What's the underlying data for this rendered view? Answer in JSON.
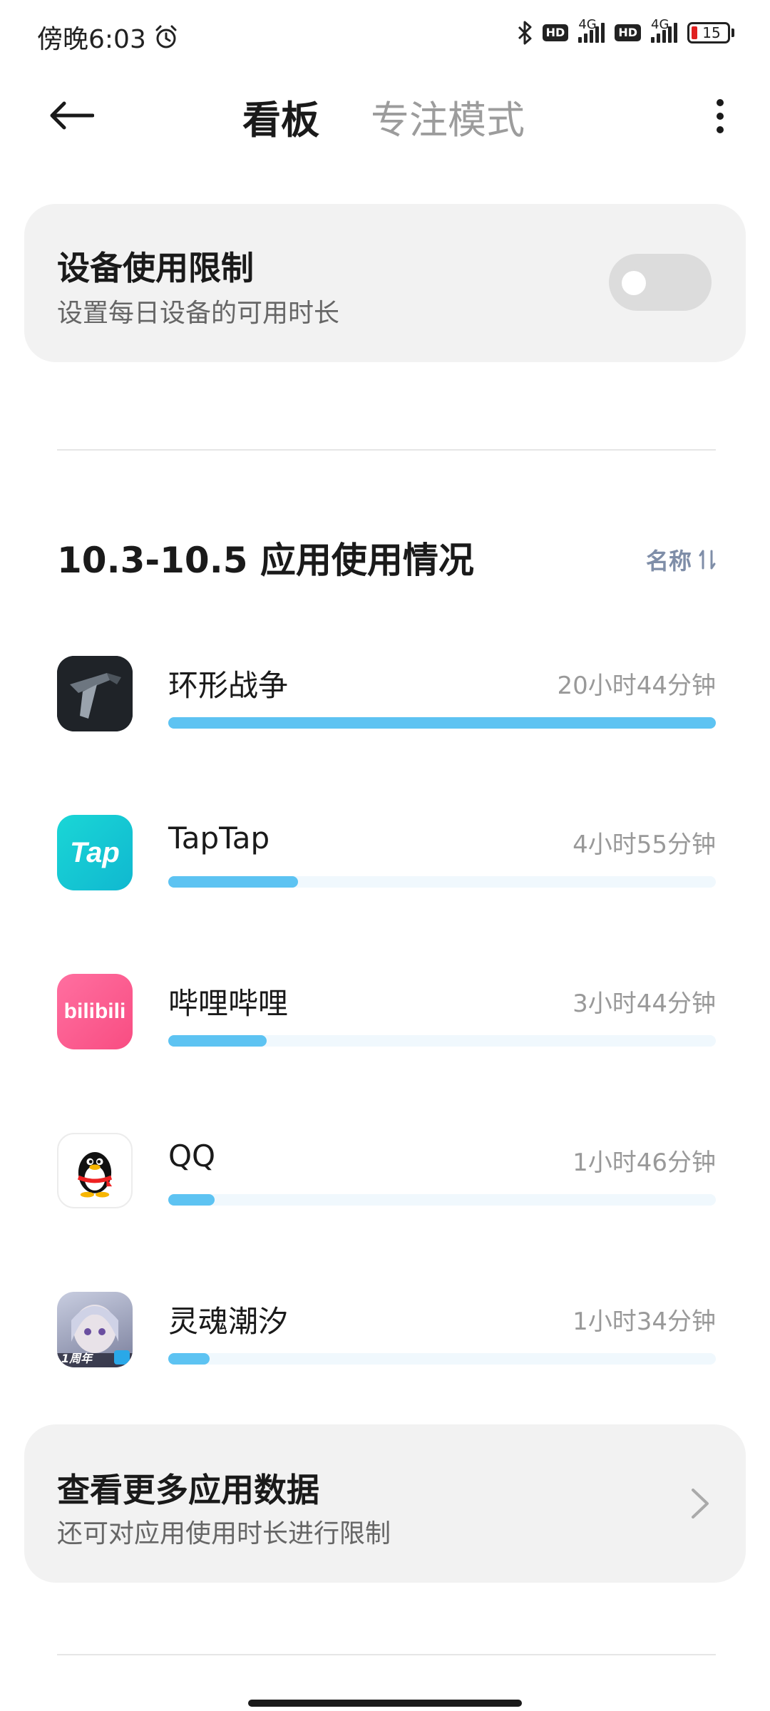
{
  "status_bar": {
    "time": "傍晚6:03",
    "network_1": "4G",
    "network_2": "4G",
    "hd": "HD",
    "battery": "15"
  },
  "header": {
    "tabs": [
      {
        "label": "看板",
        "active": true
      },
      {
        "label": "专注模式",
        "active": false
      }
    ]
  },
  "device_limit": {
    "title": "设备使用限制",
    "subtitle": "设置每日设备的可用时长",
    "enabled": false
  },
  "usage": {
    "title": "10.3-10.5 应用使用情况",
    "sort_label": "名称",
    "apps": [
      {
        "name": "环形战争",
        "time": "20小时44分钟",
        "fraction": 1.0
      },
      {
        "name": "TapTap",
        "time": "4小时55分钟",
        "fraction": 0.237
      },
      {
        "name": "哔哩哔哩",
        "time": "3小时44分钟",
        "fraction": 0.18
      },
      {
        "name": "QQ",
        "time": "1小时46分钟",
        "fraction": 0.085
      },
      {
        "name": "灵魂潮汐",
        "time": "1小时34分钟",
        "fraction": 0.075
      }
    ]
  },
  "more_apps": {
    "title": "查看更多应用数据",
    "subtitle": "还可对应用使用时长进行限制"
  },
  "icons": {
    "app_1": "Tap",
    "app_2": "bilibili",
    "app_3": "1周年"
  },
  "colors": {
    "accent_bar": "#5dc3f2",
    "taptap": "#15c8d1",
    "bilibili": "#fb5d8d"
  }
}
